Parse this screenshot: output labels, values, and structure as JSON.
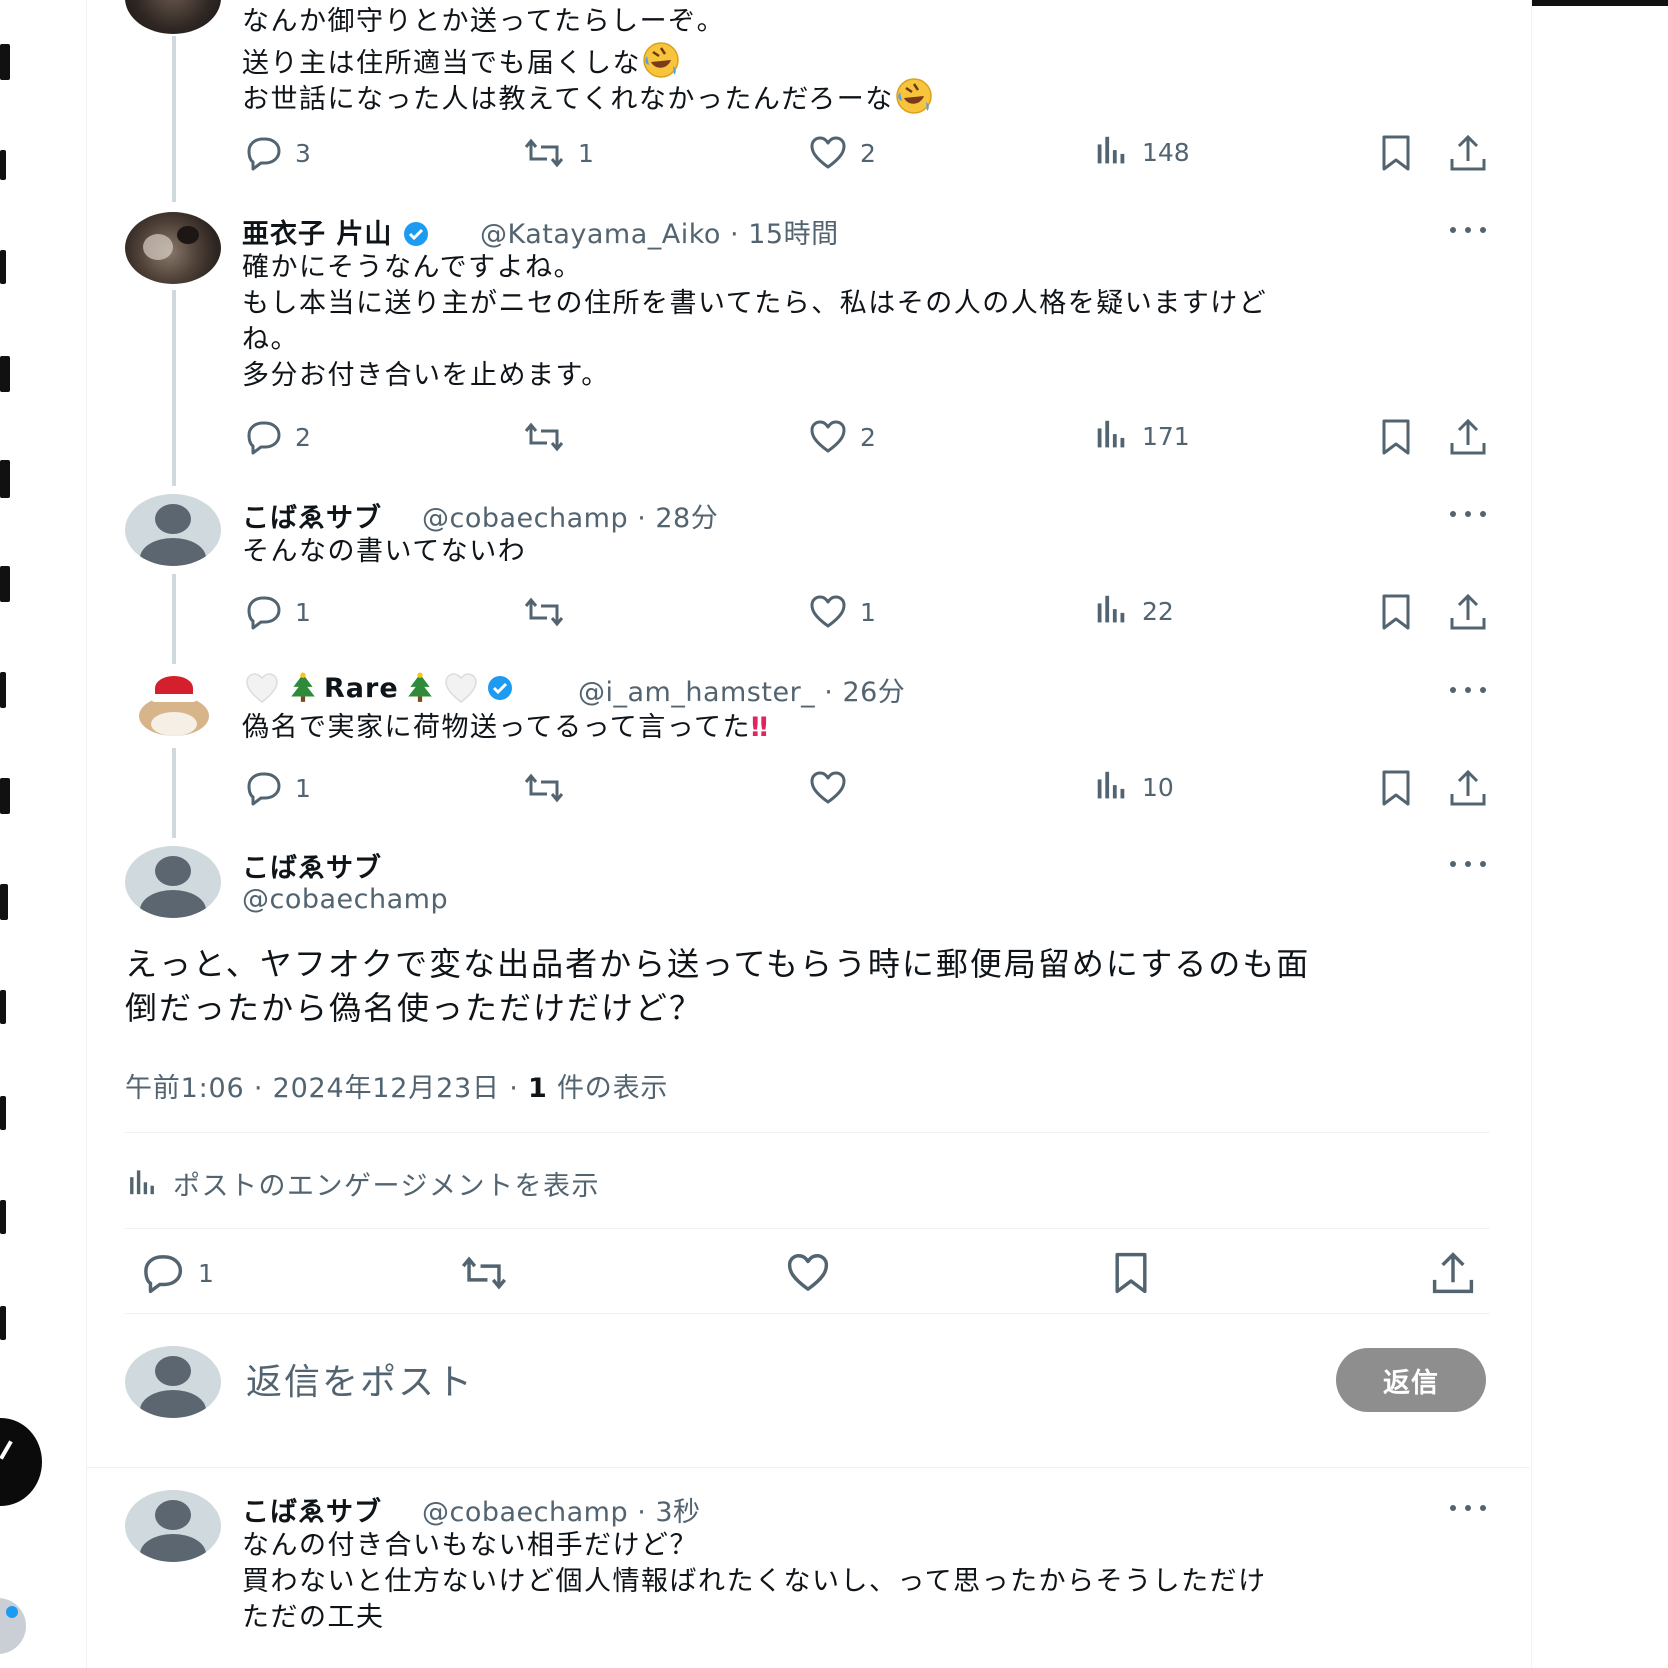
{
  "top_post": {
    "lines": [
      "なんか御守りとか送ってたらしーぞ。",
      "送り主は住所適当でも届くしな",
      "お世話になった人は教えてくれなかったんだろーな"
    ],
    "replies": "3",
    "reposts": "1",
    "likes": "2",
    "views": "148"
  },
  "post1": {
    "name": "亜衣子 片山",
    "handle": "@Katayama_Aiko",
    "time": "· 15時間",
    "lines": [
      "確かにそうなんですよね。",
      "もし本当に送り主がニセの住所を書いてたら、私はその人の人格を疑いますけど",
      "ね。",
      "多分お付き合いを止めます。"
    ],
    "replies": "2",
    "reposts": "",
    "likes": "2",
    "views": "171"
  },
  "post2": {
    "name": "こばゑサブ",
    "handle": "@cobaechamp",
    "time": "· 28分",
    "lines": [
      "そんなの書いてないわ"
    ],
    "replies": "1",
    "reposts": "",
    "likes": "1",
    "views": "22"
  },
  "post3": {
    "name": "Rare",
    "handle": "@i_am_hamster_",
    "time": "· 26分",
    "text": "偽名で実家に荷物送ってるって言ってた",
    "emphasis": "‼",
    "replies": "1",
    "reposts": "",
    "likes": "",
    "views": "10"
  },
  "main": {
    "name": "こばゑサブ",
    "handle": "@cobaechamp",
    "lines": [
      "えっと、ヤフオクで変な出品者から送ってもらう時に郵便局留めにするのも面",
      "倒だったから偽名使っただけだけど？"
    ],
    "time": "午前1:06",
    "date": "2024年12月23日",
    "views_count": "1",
    "views_label": "件の表示",
    "engagement": "ポストのエンゲージメントを表示",
    "replies": "1"
  },
  "composer": {
    "placeholder": "返信をポスト",
    "button": "返信"
  },
  "post4": {
    "name": "こばゑサブ",
    "handle": "@cobaechamp",
    "time": "· 3秒",
    "lines": [
      "なんの付き合いもない相手だけど？",
      "買わないと仕方ないけど個人情報ばれたくないし、って思ったからそうしただけ",
      "ただの工夫"
    ]
  },
  "colors": {
    "text": "#0f1419",
    "secondary": "#536471",
    "verified": "#1d9bf0",
    "thread_line": "#cfd9de",
    "reply_button": "#8e8e8e"
  },
  "icons": [
    "reply-icon",
    "repost-icon",
    "like-icon",
    "views-icon",
    "bookmark-icon",
    "share-icon",
    "more-icon",
    "verified-icon",
    "rofl-emoji",
    "tree-emoji",
    "heart-emoji",
    "double-exclamation"
  ]
}
